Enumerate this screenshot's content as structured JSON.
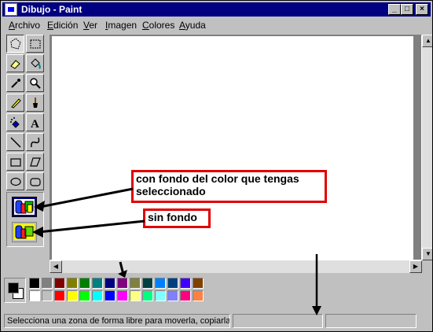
{
  "window": {
    "title": "Dibujo - Paint",
    "controls": [
      "_",
      "□",
      "×"
    ]
  },
  "menu": [
    {
      "key": "A",
      "rest": "rchivo"
    },
    {
      "key": "E",
      "rest": "dición"
    },
    {
      "key": "V",
      "rest": "er"
    },
    {
      "key": "I",
      "rest": "magen"
    },
    {
      "key": "C",
      "rest": "olores"
    },
    {
      "key": "A",
      "rest": "yuda"
    }
  ],
  "tools": [
    "free-form-select",
    "select",
    "eraser",
    "fill-with-color",
    "pick-color",
    "magnifier",
    "pencil",
    "brush",
    "airbrush",
    "text",
    "line",
    "curve",
    "rectangle",
    "polygon",
    "ellipse",
    "rounded-rectangle"
  ],
  "text_tool_glyph": "A",
  "palette": {
    "foreground": "#000000",
    "background": "#ffffff",
    "row1": [
      "#000000",
      "#808080",
      "#800000",
      "#808000",
      "#008000",
      "#008080",
      "#000080",
      "#800080",
      "#808040",
      "#004040",
      "#0080ff",
      "#004080",
      "#4000ff",
      "#804000"
    ],
    "row2": [
      "#ffffff",
      "#c0c0c0",
      "#ff0000",
      "#ffff00",
      "#00ff00",
      "#00ffff",
      "#0000ff",
      "#ff00ff",
      "#ffff80",
      "#00ff80",
      "#80ffff",
      "#8080ff",
      "#ff0080",
      "#ff8040"
    ]
  },
  "status": {
    "message": "Selecciona una zona de forma libre para moverla, copiarla o"
  },
  "annotations": {
    "opaque_label": "con fondo del color que tengas seleccionado",
    "transparent_label": "sin fondo"
  }
}
